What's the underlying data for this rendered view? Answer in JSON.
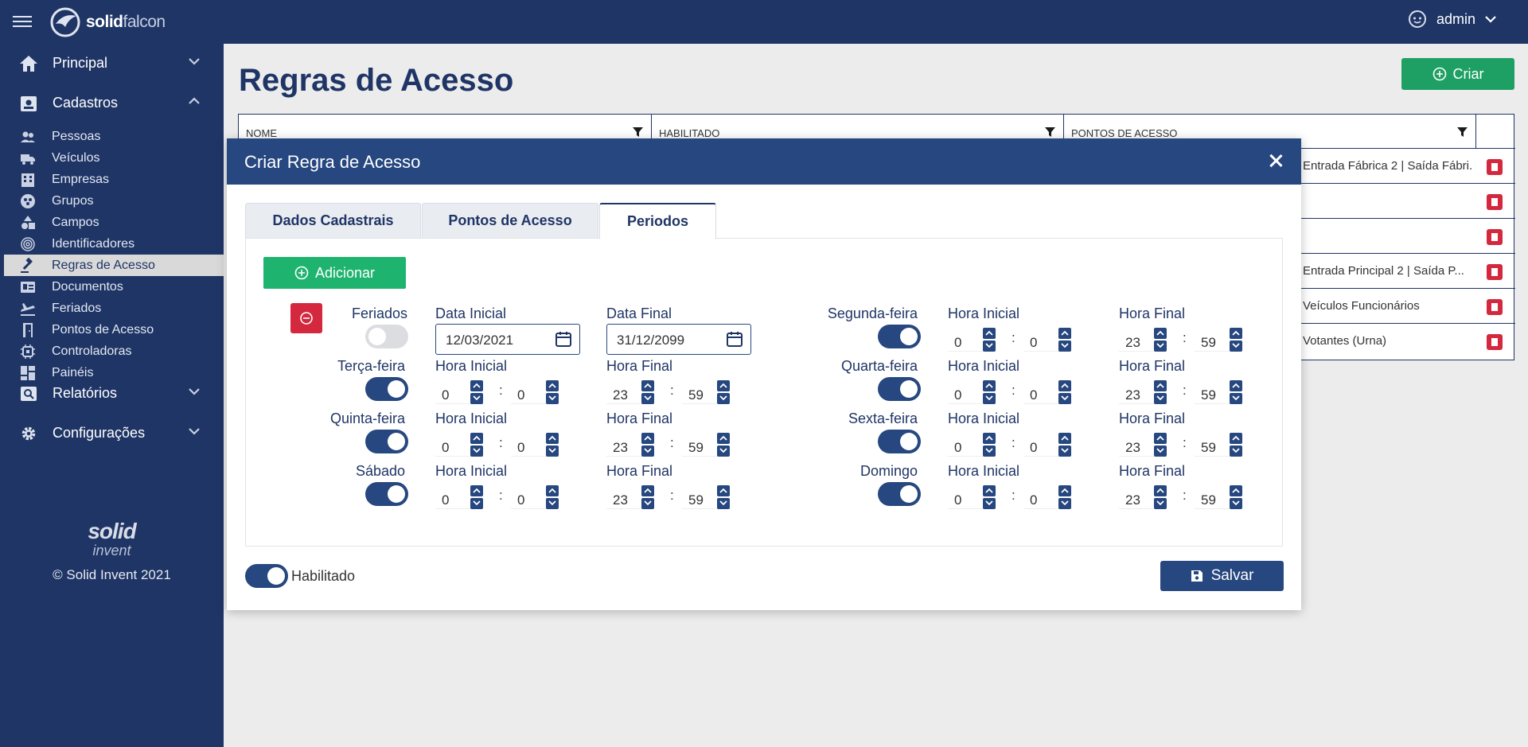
{
  "app": {
    "brand_bold": "solid",
    "brand_light": "falcon",
    "user": "admin"
  },
  "sidebar": {
    "groups": [
      {
        "label": "Principal",
        "icon": "home-icon"
      },
      {
        "label": "Cadastros",
        "icon": "id-card-icon"
      },
      {
        "label": "Relatórios",
        "icon": "report-search-icon"
      },
      {
        "label": "Configurações",
        "icon": "gear-icon"
      }
    ],
    "items": [
      {
        "label": "Pessoas",
        "icon": "users-icon"
      },
      {
        "label": "Veículos",
        "icon": "truck-icon"
      },
      {
        "label": "Empresas",
        "icon": "building-icon"
      },
      {
        "label": "Grupos",
        "icon": "group-icon"
      },
      {
        "label": "Campos",
        "icon": "shapes-icon"
      },
      {
        "label": "Identificadores",
        "icon": "fingerprint-icon"
      },
      {
        "label": "Regras de Acesso",
        "icon": "gavel-icon"
      },
      {
        "label": "Documentos",
        "icon": "document-icon"
      },
      {
        "label": "Feriados",
        "icon": "plane-icon"
      },
      {
        "label": "Pontos de Acesso",
        "icon": "door-icon"
      },
      {
        "label": "Controladoras",
        "icon": "chip-icon"
      },
      {
        "label": "Painéis",
        "icon": "dashboard-icon"
      }
    ],
    "footer_logo": "solid",
    "footer_logo_sub": "invent",
    "copyright": "© Solid Invent 2021"
  },
  "page": {
    "title": "Regras de Acesso",
    "create_label": "Criar",
    "columns": [
      "NOME",
      "HABILITADO",
      "PONTOS DE ACESSO"
    ],
    "rows": [
      {
        "pontos": "Entrada Fábrica 2 | Saída Fábri..."
      },
      {
        "pontos": ""
      },
      {
        "pontos": ""
      },
      {
        "pontos": "Entrada Principal 2 | Saída P..."
      },
      {
        "pontos": "Veículos Funcionários"
      },
      {
        "pontos": "Votantes (Urna)"
      }
    ]
  },
  "modal": {
    "title": "Criar Regra de Acesso",
    "tabs": [
      "Dados Cadastrais",
      "Pontos de Acesso",
      "Periodos"
    ],
    "active_tab": "Periodos",
    "add_label": "Adicionar",
    "holidays_label": "Feriados",
    "holidays_enabled": false,
    "start_date_label": "Data Inicial",
    "start_date": "12/03/2021",
    "end_date_label": "Data Final",
    "end_date": "31/12/2099",
    "start_time_label": "Hora Inicial",
    "end_time_label": "Hora Final",
    "time_separator": ":",
    "days": [
      {
        "name": "Segunda-feira",
        "enabled": true,
        "start_h": "0",
        "start_m": "0",
        "end_h": "23",
        "end_m": "59"
      },
      {
        "name": "Terça-feira",
        "enabled": true,
        "start_h": "0",
        "start_m": "0",
        "end_h": "23",
        "end_m": "59"
      },
      {
        "name": "Quarta-feira",
        "enabled": true,
        "start_h": "0",
        "start_m": "0",
        "end_h": "23",
        "end_m": "59"
      },
      {
        "name": "Quinta-feira",
        "enabled": true,
        "start_h": "0",
        "start_m": "0",
        "end_h": "23",
        "end_m": "59"
      },
      {
        "name": "Sexta-feira",
        "enabled": true,
        "start_h": "0",
        "start_m": "0",
        "end_h": "23",
        "end_m": "59"
      },
      {
        "name": "Sábado",
        "enabled": true,
        "start_h": "0",
        "start_m": "0",
        "end_h": "23",
        "end_m": "59"
      },
      {
        "name": "Domingo",
        "enabled": true,
        "start_h": "0",
        "start_m": "0",
        "end_h": "23",
        "end_m": "59"
      }
    ],
    "enabled_label": "Habilitado",
    "enabled": true,
    "save_label": "Salvar"
  },
  "colors": {
    "navy": "#1f3566",
    "modal_header": "#26477f",
    "green": "#1eb46f",
    "red": "#d4283e"
  }
}
